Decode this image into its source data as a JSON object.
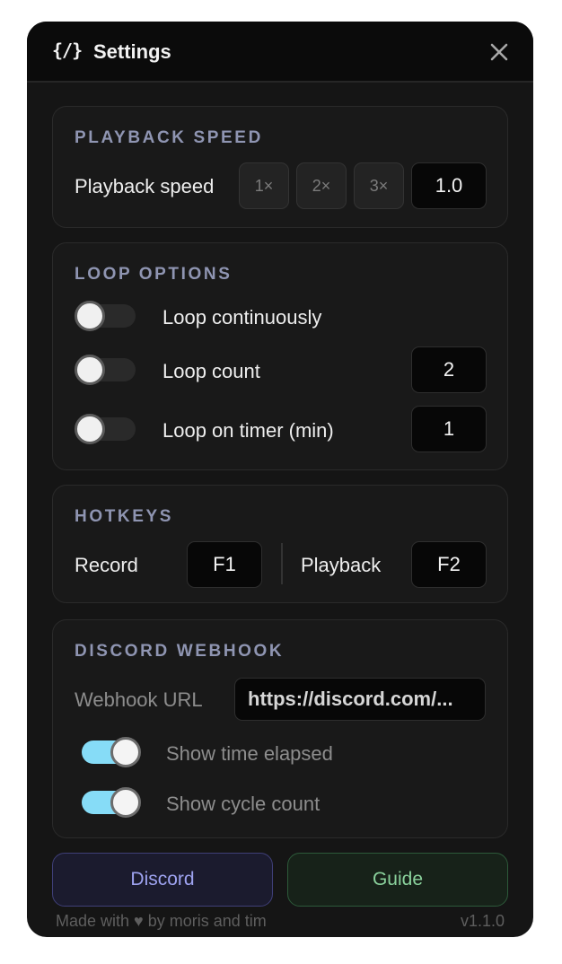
{
  "header": {
    "logo": "{/}",
    "title": "Settings",
    "close_icon": "close-icon"
  },
  "playback": {
    "section_title": "PLAYBACK SPEED",
    "label": "Playback speed",
    "presets": [
      "1×",
      "2×",
      "3×"
    ],
    "value": "1.0"
  },
  "loop": {
    "section_title": "LOOP OPTIONS",
    "continuous_label": "Loop continuously",
    "continuous_on": false,
    "count_label": "Loop count",
    "count_on": false,
    "count_value": "2",
    "timer_label": "Loop on timer (min)",
    "timer_on": false,
    "timer_value": "1"
  },
  "hotkeys": {
    "section_title": "HOTKEYS",
    "record_label": "Record",
    "record_key": "F1",
    "playback_label": "Playback",
    "playback_key": "F2"
  },
  "webhook": {
    "section_title": "DISCORD WEBHOOK",
    "url_label": "Webhook URL",
    "url_value": "https://discord.com/...",
    "time_label": "Show time elapsed",
    "time_on": true,
    "cycle_label": "Show cycle count",
    "cycle_on": true
  },
  "buttons": {
    "discord": "Discord",
    "guide": "Guide"
  },
  "footer": {
    "credit": "Made with ♥ by moris and tim",
    "version": "v1.1.0"
  },
  "colors": {
    "toggle_on": "#86dcf7",
    "section_title": "#8f95b2",
    "discord_accent": "#9ea3f0",
    "guide_accent": "#8ad19c"
  }
}
